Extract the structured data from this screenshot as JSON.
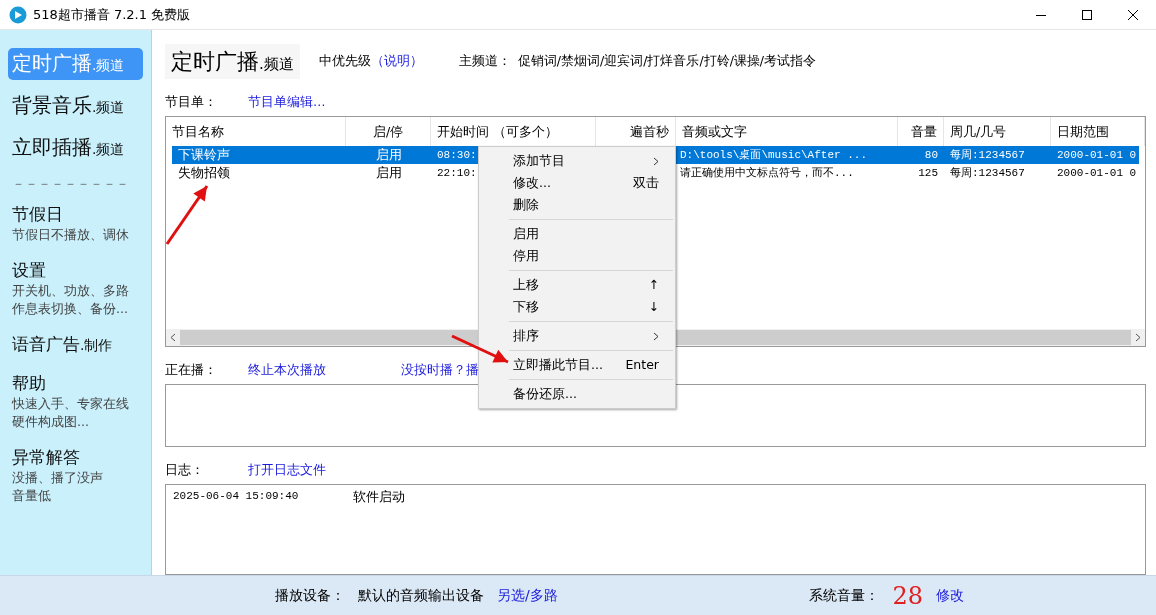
{
  "window": {
    "title": "518超市播音 7.2.1 免费版"
  },
  "sidebar": {
    "channels": [
      {
        "name": "定时广播",
        "suffix": ".频道",
        "selected": true
      },
      {
        "name": "背景音乐",
        "suffix": ".频道",
        "selected": false
      },
      {
        "name": "立即插播",
        "suffix": ".频道",
        "selected": false
      }
    ],
    "divider": "－－－－－－－－－",
    "sections": [
      {
        "title": "节假日",
        "lines": [
          "节假日不播放、调休"
        ]
      },
      {
        "title": "设置",
        "lines": [
          "开关机、功放、多路",
          "作息表切换、备份..."
        ]
      },
      {
        "title": "语音广告",
        "suffix": ".制作"
      },
      {
        "title": "帮助",
        "lines": [
          "快速入手、专家在线",
          "硬件构成图..."
        ]
      },
      {
        "title": "异常解答",
        "lines": [
          "没播、播了没声",
          "音量低"
        ]
      }
    ]
  },
  "header": {
    "title": "定时广播",
    "suffix": ".频道",
    "priority": "中优先级",
    "priority_link": "（说明）",
    "main_channel_label": "主频道：",
    "main_channel_value": "促销词/禁烟词/迎宾词/打烊音乐/打铃/课操/考试指令"
  },
  "playlist": {
    "label": "节目单：",
    "edit_link": "节目单编辑…",
    "columns": [
      "节目名称",
      "启/停",
      "开始时间 （可多个）",
      "遍首秒",
      "音频或文字",
      "音量",
      "周几/几号",
      "日期范围"
    ],
    "rows": [
      {
        "selected": true,
        "cells": [
          "下课铃声",
          "启用",
          "08:30:",
          null,
          "D:\\tools\\桌面\\music\\After ...",
          "80",
          "每周:1234567",
          "2000-01-01 0"
        ]
      },
      {
        "selected": false,
        "cells": [
          "失物招领",
          "启用",
          "22:10:",
          null,
          "请正确使用中文标点符号，而不...",
          "125",
          "每周:1234567",
          "2000-01-01 0"
        ]
      }
    ]
  },
  "context_menu": [
    {
      "kind": "item",
      "label": "添加节目",
      "submenu": true
    },
    {
      "kind": "item",
      "label": "修改...",
      "shortcut": "双击"
    },
    {
      "kind": "item",
      "label": "删除"
    },
    {
      "kind": "separator"
    },
    {
      "kind": "item",
      "label": "启用"
    },
    {
      "kind": "item",
      "label": "停用"
    },
    {
      "kind": "separator"
    },
    {
      "kind": "item",
      "label": "上移",
      "shortcut": "↑"
    },
    {
      "kind": "item",
      "label": "下移",
      "shortcut": "↓"
    },
    {
      "kind": "separator"
    },
    {
      "kind": "item",
      "label": "排序",
      "submenu": true
    },
    {
      "kind": "separator"
    },
    {
      "kind": "item",
      "label": "立即播此节目...",
      "shortcut": "Enter"
    },
    {
      "kind": "separator"
    },
    {
      "kind": "item",
      "label": "备份还原..."
    }
  ],
  "now_playing": {
    "label": "正在播：",
    "stop_link": "终止本次播放",
    "help_link": "没按时播？播"
  },
  "log": {
    "label": "日志：",
    "open_link": "打开日志文件",
    "entries": [
      {
        "time": "2025-06-04 15:09:40",
        "message": "软件启动"
      }
    ]
  },
  "status_bar": {
    "device_label": "播放设备：",
    "device": "默认的音频输出设备",
    "device_link": "另选/多路",
    "volume_label": "系统音量：",
    "volume": "28",
    "volume_link": "修改"
  }
}
